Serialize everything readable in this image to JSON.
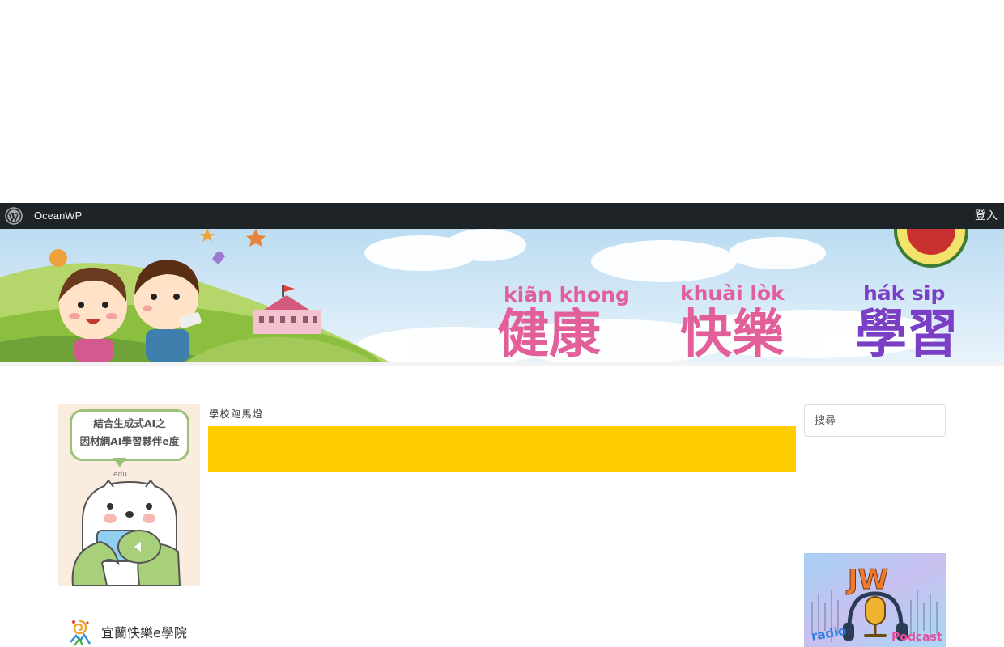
{
  "adminbar": {
    "site_name": "OceanWP",
    "login_label": "登入"
  },
  "banner": {
    "words": [
      {
        "romanization": "kiãn khong",
        "hanzi": "健康"
      },
      {
        "romanization": "khuài lòk",
        "hanzi": "快樂"
      },
      {
        "romanization": "hák  sip",
        "hanzi": "學習"
      }
    ],
    "colors": {
      "sky": "#c9e3f4",
      "pink": "#e35f9a",
      "purple": "#7a3fc4",
      "grass": "#8cbf3f"
    }
  },
  "sidebar_left": {
    "promo_text_line1": "結合生成式AI之",
    "promo_text_line2": "因材網AI學習夥伴e度",
    "promo_brand": "edu",
    "eacademy_label": "宜蘭快樂e學院"
  },
  "main": {
    "marquee_title": "學校跑馬燈",
    "marquee_color": "#ffcc00"
  },
  "sidebar_right": {
    "search_placeholder": "搜尋",
    "radio_title": "JW",
    "radio_left": "radio",
    "radio_right": "Podcast"
  }
}
